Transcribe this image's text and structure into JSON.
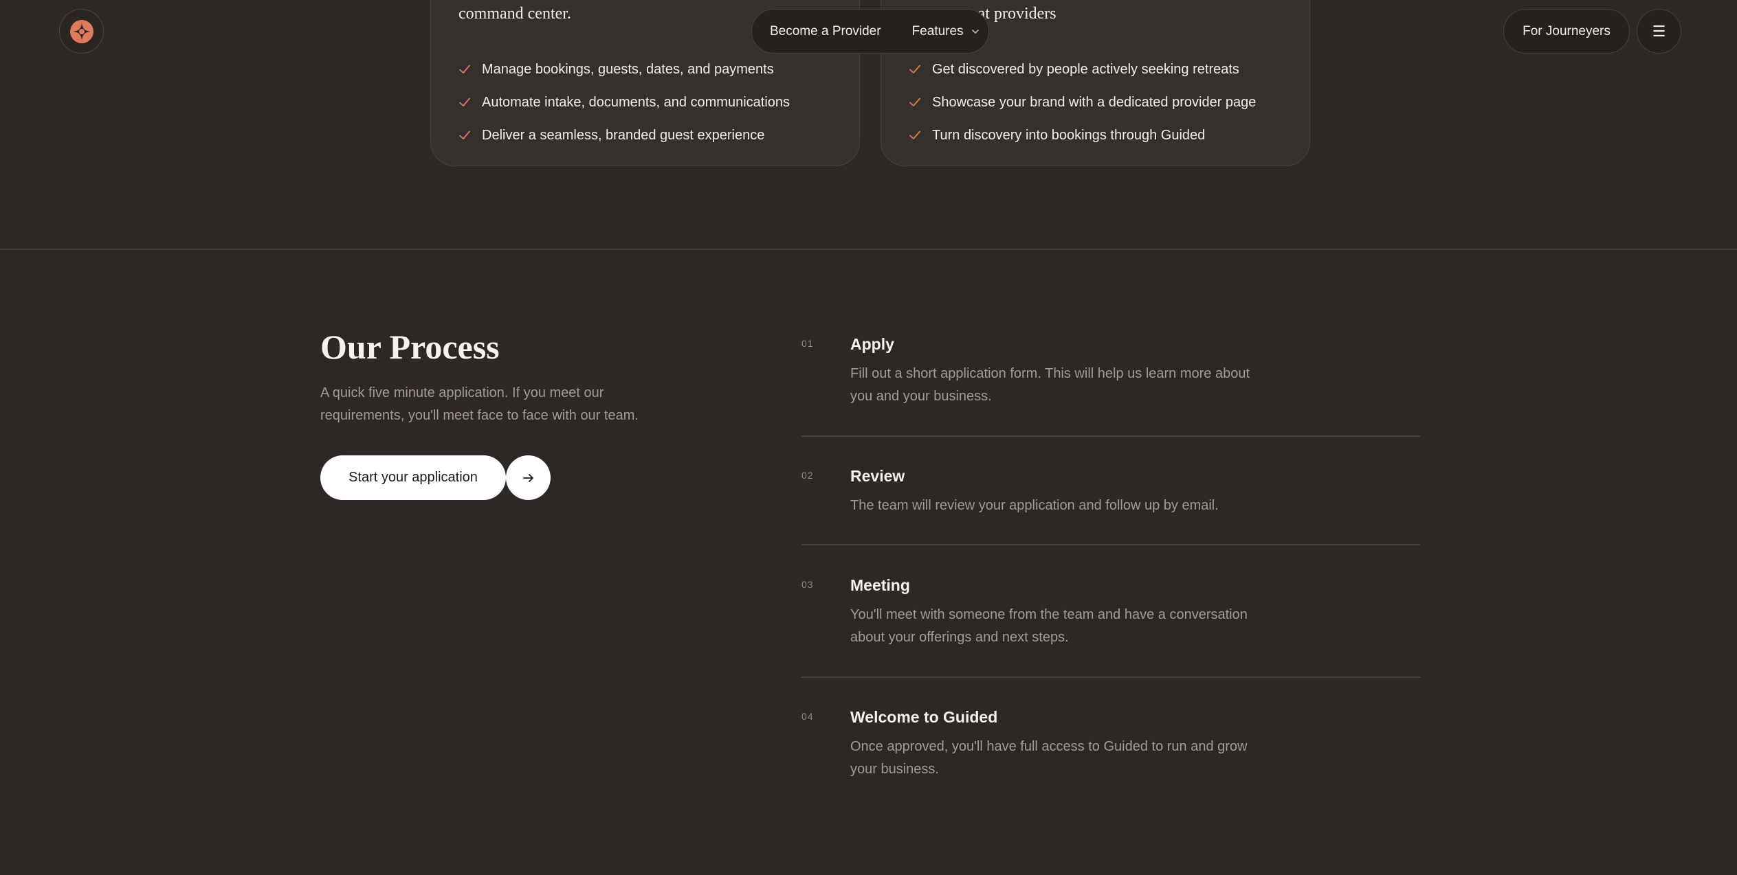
{
  "header": {
    "nav": {
      "become_provider": "Become a Provider",
      "features": "Features"
    },
    "journeyers_button": "For Journeyers",
    "menu_icon": "☰"
  },
  "cards": {
    "left": {
      "heading": "command center.",
      "items": [
        "Manage bookings, guests, dates, and payments",
        "Automate intake, documents, and communications",
        "Deliver a seamless, branded guest experience"
      ]
    },
    "right": {
      "heading": "reat providers",
      "items": [
        "Get discovered by people actively seeking retreats",
        "Showcase your brand with a dedicated provider page",
        "Turn discovery into bookings through Guided"
      ]
    }
  },
  "process": {
    "title": "Our Process",
    "description": "A quick five minute application. If you meet our requirements, you'll meet face to face with our team.",
    "cta_label": "Start your application",
    "steps": [
      {
        "num": "01",
        "title": "Apply",
        "desc": "Fill out a short application form. This will help us learn more about you and your business."
      },
      {
        "num": "02",
        "title": "Review",
        "desc": "The team will review your application and follow up by email."
      },
      {
        "num": "03",
        "title": "Meeting",
        "desc": "You'll meet with someone from the team and have a conversation about your offerings and next steps."
      },
      {
        "num": "04",
        "title": "Welcome to Guided",
        "desc": "Once approved, you'll have full access to Guided to run and grow your business."
      }
    ]
  },
  "colors": {
    "background": "#2d2824",
    "card": "#35302b",
    "accent": "#e07a5f",
    "text": "#f2ede8",
    "muted": "#a39b93"
  }
}
